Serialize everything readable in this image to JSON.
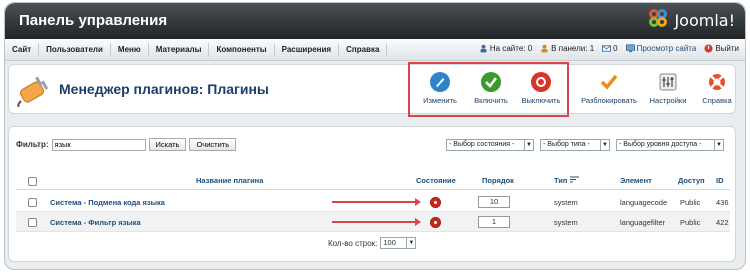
{
  "header": {
    "title": "Панель управления",
    "logo_text": "Joomla!"
  },
  "menu": {
    "items": [
      "Сайт",
      "Пользователи",
      "Меню",
      "Материалы",
      "Компоненты",
      "Расширения",
      "Справка"
    ]
  },
  "status": {
    "on_site": "На сайте: 0",
    "in_panel": "В панели: 1",
    "messages": "0",
    "view_site": "Просмотр сайта",
    "logout": "Выйти"
  },
  "toolbar": {
    "title": "Менеджер плагинов: Плагины",
    "buttons": [
      "Изменить",
      "Включить",
      "Выключить",
      "Разблокировать",
      "Настройки",
      "Справка"
    ]
  },
  "filter": {
    "label": "Фильтр:",
    "value": "язык",
    "search_label": "Искать",
    "clear_label": "Очистить",
    "state_select": "- Выбор состояния -",
    "type_select": "- Выбор типа -",
    "access_select": "- Выбор уровня доступа -"
  },
  "table": {
    "headers": {
      "name": "Название плагина",
      "state": "Состояние",
      "order": "Порядок",
      "type": "Тип",
      "element": "Элемент",
      "access": "Доступ",
      "id": "ID"
    },
    "rows": [
      {
        "name": "Система - Подмена кода языка",
        "order": "10",
        "type": "system",
        "element": "languagecode",
        "access": "Public",
        "id": "436"
      },
      {
        "name": "Система - Фильтр языка",
        "order": "1",
        "type": "system",
        "element": "languagefilter",
        "access": "Public",
        "id": "422"
      }
    ]
  },
  "pager": {
    "label": "Кол-во строк:",
    "value": "100"
  },
  "colors": {
    "accent": "#1b3f66",
    "highlight": "#d8464a",
    "disabled_state": "#c8281c"
  }
}
